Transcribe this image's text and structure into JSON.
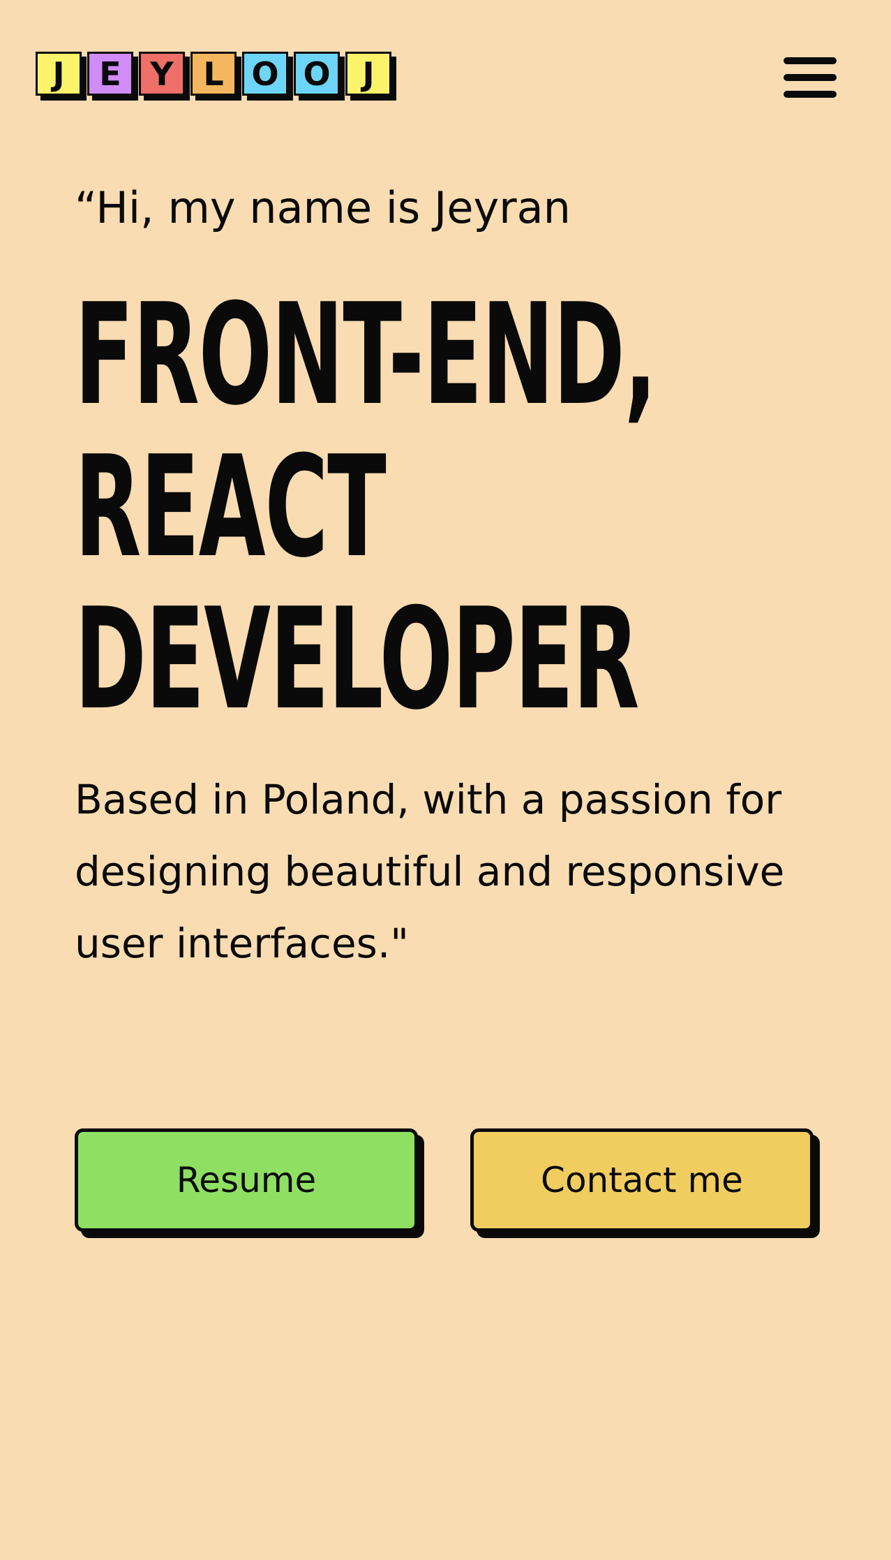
{
  "header": {
    "logo": {
      "letters": [
        {
          "char": "J",
          "color": "#fbf46b"
        },
        {
          "char": "E",
          "color": "#d28cf8"
        },
        {
          "char": "Y",
          "color": "#ee7068"
        },
        {
          "char": "L",
          "color": "#f4b65f"
        },
        {
          "char": "O",
          "color": "#6dd6f6"
        },
        {
          "char": "O",
          "color": "#6dd6f6"
        },
        {
          "char": "J",
          "color": "#fbf46b"
        }
      ]
    },
    "menu_icon": "hamburger-menu-icon"
  },
  "hero": {
    "greeting": "“Hi, my name is Jeyran",
    "headline": [
      "FRONT-END,",
      "REACT",
      "DEVELOPER"
    ],
    "intro": "Based in Poland, with a passion for designing beautiful and responsive user interfaces.\""
  },
  "buttons": {
    "resume": {
      "label": "Resume",
      "color": "#8fe062"
    },
    "contact": {
      "label": "Contact me",
      "color": "#f0cd5e"
    }
  },
  "colors": {
    "background": "#fadcb2",
    "ink": "#0a0a0a"
  }
}
